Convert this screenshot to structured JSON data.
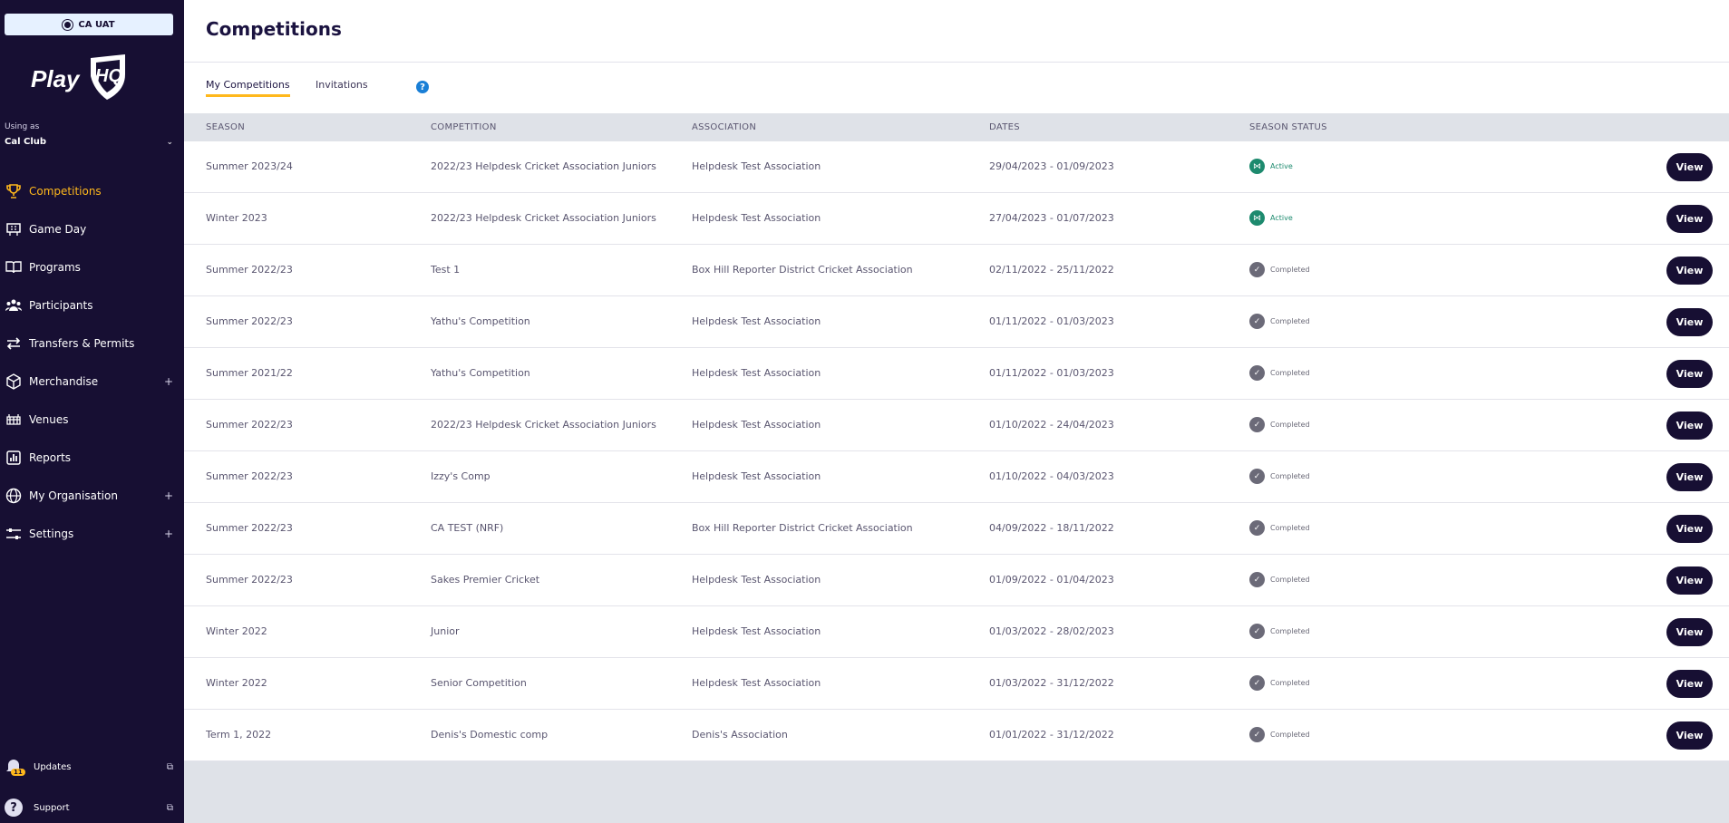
{
  "sidebar": {
    "env": "CA UAT",
    "logo": {
      "text_play": "Play",
      "text_hq": "HQ"
    },
    "using_as": "Using as",
    "club": "Cal Club",
    "items": [
      {
        "label": "Competitions",
        "icon": "trophy-icon",
        "expandable": false,
        "active": true
      },
      {
        "label": "Game Day",
        "icon": "scoreboard-icon",
        "expandable": false
      },
      {
        "label": "Programs",
        "icon": "book-icon",
        "expandable": false
      },
      {
        "label": "Participants",
        "icon": "people-icon",
        "expandable": false
      },
      {
        "label": "Transfers & Permits",
        "icon": "transfer-icon",
        "expandable": false
      },
      {
        "label": "Merchandise",
        "icon": "box-icon",
        "expandable": true
      },
      {
        "label": "Venues",
        "icon": "stadium-icon",
        "expandable": false
      },
      {
        "label": "Reports",
        "icon": "report-icon",
        "expandable": false
      },
      {
        "label": "My Organisation",
        "icon": "globe-icon",
        "expandable": true
      },
      {
        "label": "Settings",
        "icon": "sliders-icon",
        "expandable": true
      }
    ],
    "updates": {
      "label": "Updates",
      "badge": "11"
    },
    "support": {
      "label": "Support"
    }
  },
  "header": {
    "title": "Competitions"
  },
  "tabs": {
    "my": "My Competitions",
    "invitations": "Invitations",
    "help": "?"
  },
  "table": {
    "columns": {
      "season": "SEASON",
      "competition": "COMPETITION",
      "association": "ASSOCIATION",
      "dates": "DATES",
      "status": "SEASON STATUS"
    },
    "view_label": "View",
    "rows": [
      {
        "season": "Summer 2023/24",
        "competition": "2022/23 Helpdesk Cricket Association Juniors",
        "association": "Helpdesk Test Association",
        "dates": "29/04/2023 - 01/09/2023",
        "status": "Active"
      },
      {
        "season": "Winter 2023",
        "competition": "2022/23 Helpdesk Cricket Association Juniors",
        "association": "Helpdesk Test Association",
        "dates": "27/04/2023 - 01/07/2023",
        "status": "Active"
      },
      {
        "season": "Summer 2022/23",
        "competition": "Test 1",
        "association": "Box Hill Reporter District Cricket Association",
        "dates": "02/11/2022 - 25/11/2022",
        "status": "Completed"
      },
      {
        "season": "Summer 2022/23",
        "competition": "Yathu's Competition",
        "association": "Helpdesk Test Association",
        "dates": "01/11/2022 - 01/03/2023",
        "status": "Completed"
      },
      {
        "season": "Summer 2021/22",
        "competition": "Yathu's Competition",
        "association": "Helpdesk Test Association",
        "dates": "01/11/2022 - 01/03/2023",
        "status": "Completed"
      },
      {
        "season": "Summer 2022/23",
        "competition": "2022/23 Helpdesk Cricket Association Juniors",
        "association": "Helpdesk Test Association",
        "dates": "01/10/2022 - 24/04/2023",
        "status": "Completed"
      },
      {
        "season": "Summer 2022/23",
        "competition": "Izzy's Comp",
        "association": "Helpdesk Test Association",
        "dates": "01/10/2022 - 04/03/2023",
        "status": "Completed"
      },
      {
        "season": "Summer 2022/23",
        "competition": "CA TEST (NRF)",
        "association": "Box Hill Reporter District Cricket Association",
        "dates": "04/09/2022 - 18/11/2022",
        "status": "Completed"
      },
      {
        "season": "Summer 2022/23",
        "competition": "Sakes Premier Cricket",
        "association": "Helpdesk Test Association",
        "dates": "01/09/2022 - 01/04/2023",
        "status": "Completed"
      },
      {
        "season": "Winter 2022",
        "competition": "Junior",
        "association": "Helpdesk Test Association",
        "dates": "01/03/2022 - 28/02/2023",
        "status": "Completed"
      },
      {
        "season": "Winter 2022",
        "competition": "Senior Competition",
        "association": "Helpdesk Test Association",
        "dates": "01/03/2022 - 31/12/2022",
        "status": "Completed"
      },
      {
        "season": "Term 1, 2022",
        "competition": "Denis's Domestic comp",
        "association": "Denis's Association",
        "dates": "01/01/2022 - 31/12/2022",
        "status": "Completed"
      }
    ]
  },
  "colors": {
    "sidebar_bg": "#170f33",
    "accent": "#ffb81c",
    "active_status": "#1d8a6e",
    "completed_status": "#6b6a78"
  }
}
